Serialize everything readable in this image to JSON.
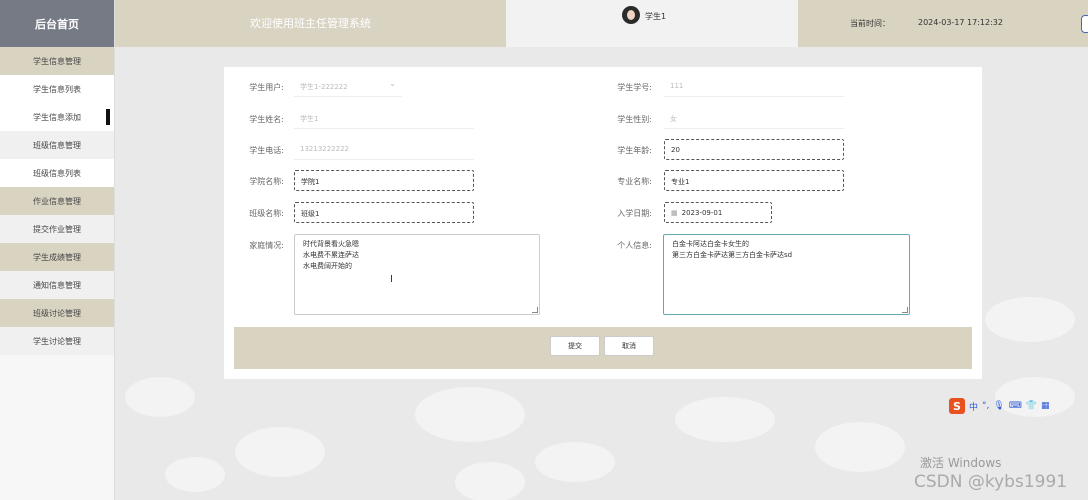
{
  "sidebar": {
    "logo": "后台首页",
    "items": [
      {
        "label": "学生信息管理",
        "type": "group"
      },
      {
        "label": "学生信息列表",
        "type": "sub"
      },
      {
        "label": "学生信息添加",
        "type": "sub",
        "active": true
      },
      {
        "label": "班级信息管理",
        "type": "plain"
      },
      {
        "label": "班级信息列表",
        "type": "sub"
      },
      {
        "label": "作业信息管理",
        "type": "group"
      },
      {
        "label": "提交作业管理",
        "type": "plain"
      },
      {
        "label": "学生成绩管理",
        "type": "group"
      },
      {
        "label": "通知信息管理",
        "type": "plain"
      },
      {
        "label": "班级讨论管理",
        "type": "group"
      },
      {
        "label": "学生讨论管理",
        "type": "plain"
      }
    ]
  },
  "header": {
    "title": "欢迎使用班主任管理系统",
    "username": "学生1",
    "time_label": "当前时间：",
    "time_value": "2024-03-17 17:12:32"
  },
  "form": {
    "student_user": {
      "label": "学生用户:",
      "value": "学生1-222222"
    },
    "student_no": {
      "label": "学生学号:",
      "value": "111"
    },
    "student_name": {
      "label": "学生姓名:",
      "value": "学生1"
    },
    "student_gender": {
      "label": "学生性别:",
      "value": "女"
    },
    "student_phone": {
      "label": "学生电话:",
      "value": "13213222222"
    },
    "student_age": {
      "label": "学生年龄:",
      "value": "20"
    },
    "college": {
      "label": "学院名称:",
      "value": "学院1"
    },
    "major": {
      "label": "专业名称:",
      "value": "专业1"
    },
    "class_name": {
      "label": "班级名称:",
      "value": "班级1"
    },
    "enroll_date": {
      "label": "入学日期:",
      "value": "2023-09-01"
    },
    "family": {
      "label": "家庭情况:",
      "value": "时代背景看火急嗯\n水电费不累连萨达\n水电费阔开始的"
    },
    "personal": {
      "label": "个人信息:",
      "value": "白金卡阿达白金卡女生的\n第三方白金卡萨达第三方白金卡萨达sd"
    }
  },
  "buttons": {
    "submit": "提交",
    "cancel": "取消"
  },
  "ime": {
    "cn": "中",
    "symbols": "°,"
  },
  "watermark": {
    "line1": "激活 Windows",
    "line2": "CSDN @kybs1991"
  }
}
